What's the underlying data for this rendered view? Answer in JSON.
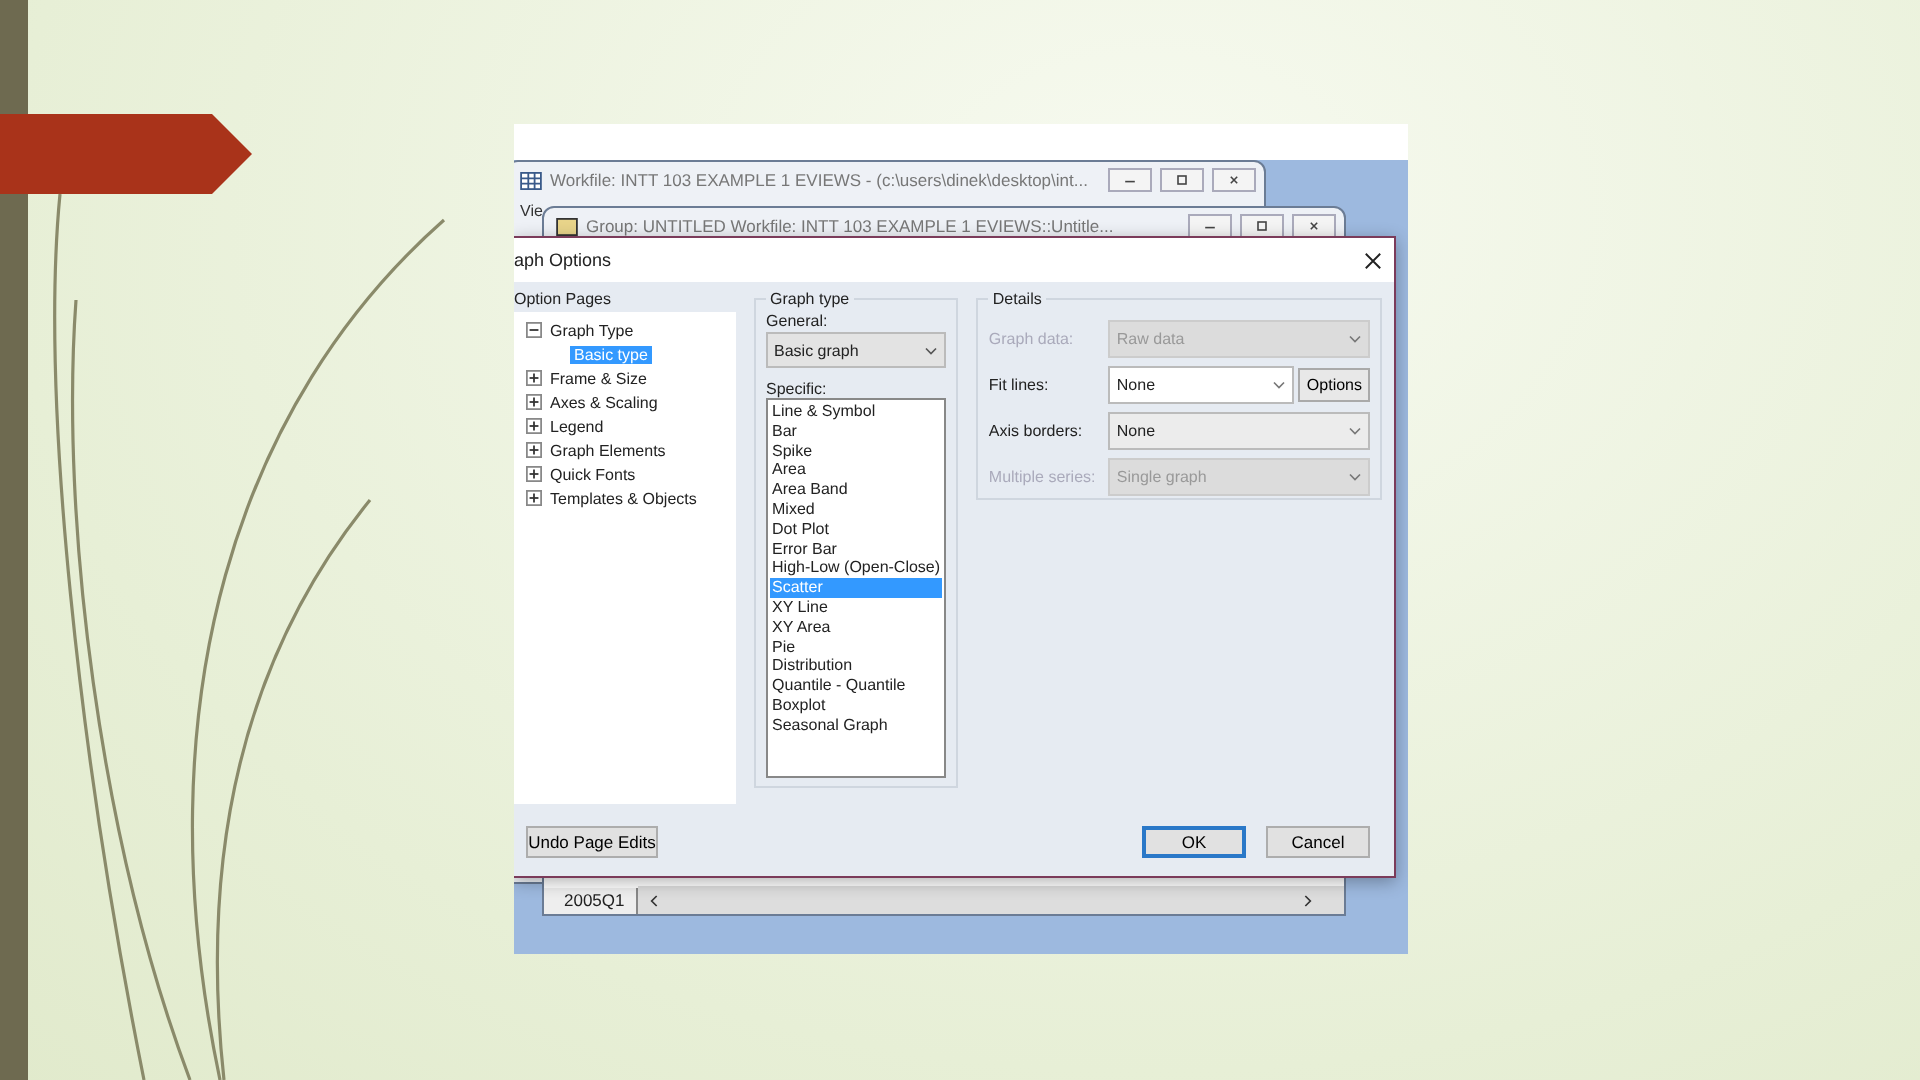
{
  "back_windows": [
    {
      "title": "Workfile: INTT 103 EXAMPLE 1 EVIEWS - (c:\\users\\dinek\\desktop\\int..."
    },
    {
      "title": "Group: UNTITLED   Workfile: INTT 103 EXAMPLE 1 EVIEWS::Untitle..."
    }
  ],
  "menu_fragment": "Vie",
  "dialog": {
    "title": "aph Options",
    "option_pages_label": "Option Pages",
    "tree": [
      {
        "label": "Graph Type",
        "expanded": true,
        "selected": false,
        "children": [
          {
            "label": "Basic type",
            "selected": true
          }
        ]
      },
      {
        "label": "Frame & Size",
        "expanded": false,
        "selected": false
      },
      {
        "label": "Axes & Scaling",
        "expanded": false,
        "selected": false
      },
      {
        "label": "Legend",
        "expanded": false,
        "selected": false
      },
      {
        "label": "Graph Elements",
        "expanded": false,
        "selected": false
      },
      {
        "label": "Quick Fonts",
        "expanded": false,
        "selected": false
      },
      {
        "label": "Templates & Objects",
        "expanded": false,
        "selected": false
      }
    ],
    "graph_type": {
      "legend": "Graph type",
      "general_label": "General:",
      "general_value": "Basic graph",
      "specific_label": "Specific:",
      "specific": [
        {
          "label": "Line & Symbol",
          "selected": false
        },
        {
          "label": "Bar",
          "selected": false
        },
        {
          "label": "Spike",
          "selected": false
        },
        {
          "label": "Area",
          "selected": false
        },
        {
          "label": "Area Band",
          "selected": false
        },
        {
          "label": "Mixed",
          "selected": false
        },
        {
          "label": "Dot Plot",
          "selected": false
        },
        {
          "label": "Error Bar",
          "selected": false
        },
        {
          "label": "High-Low (Open-Close)",
          "selected": false
        },
        {
          "label": "Scatter",
          "selected": true
        },
        {
          "label": "XY Line",
          "selected": false
        },
        {
          "label": "XY Area",
          "selected": false
        },
        {
          "label": "Pie",
          "selected": false
        },
        {
          "label": "Distribution",
          "selected": false
        },
        {
          "label": "Quantile - Quantile",
          "selected": false
        },
        {
          "label": "Boxplot",
          "selected": false
        },
        {
          "label": "Seasonal Graph",
          "selected": false
        }
      ]
    },
    "details": {
      "legend": "Details",
      "rows": [
        {
          "label": "Graph data:",
          "value": "Raw data",
          "disabled": true
        },
        {
          "label": "Fit lines:",
          "value": "None",
          "disabled": false,
          "button": "Options"
        },
        {
          "label": "Axis borders:",
          "value": "None",
          "disabled": false
        },
        {
          "label": "Multiple series:",
          "value": "Single graph",
          "disabled": true
        }
      ]
    },
    "undo_button": "Undo Page Edits",
    "ok_button": "OK",
    "cancel_button": "Cancel"
  },
  "sheet": {
    "row_label": "2005Q1"
  }
}
